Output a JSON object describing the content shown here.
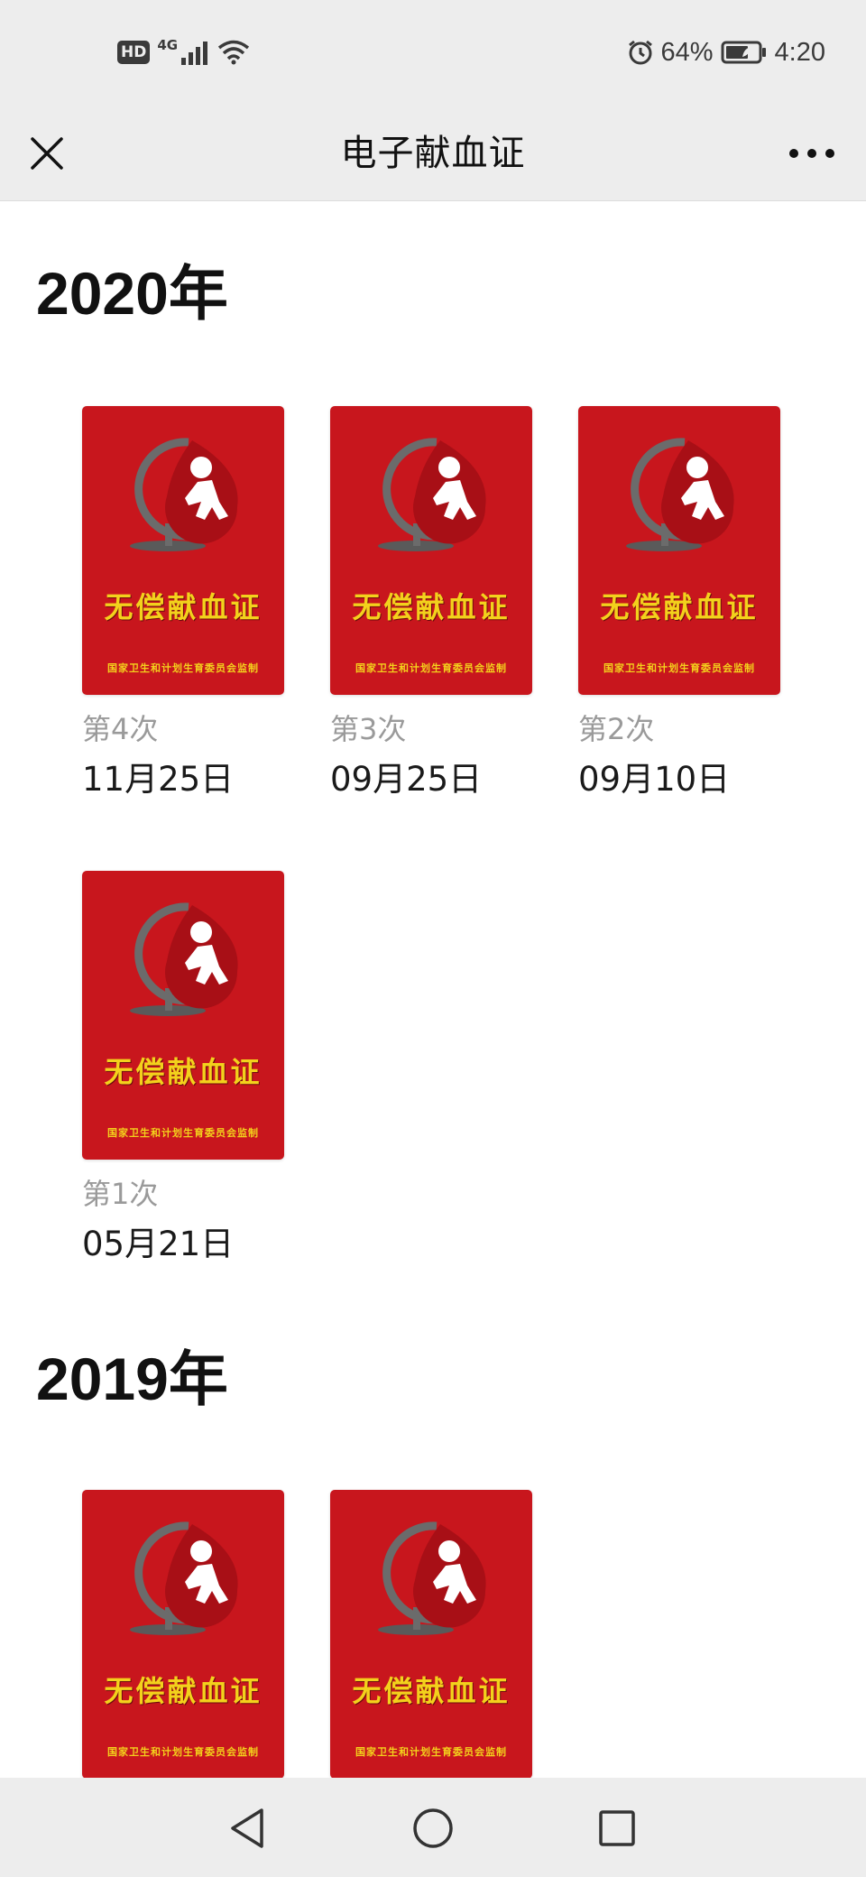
{
  "status_bar": {
    "hd": "HD",
    "network": "4G",
    "battery": "64%",
    "time": "4:20"
  },
  "nav": {
    "title": "电子献血证"
  },
  "card": {
    "title": "无偿献血证",
    "footer": "国家卫生和计划生育委员会监制",
    "colors": {
      "background": "#c8161d",
      "title": "#f3d11c",
      "globe": "#6b6b6b"
    }
  },
  "sections": [
    {
      "year": "2020年",
      "items": [
        {
          "count": "第4次",
          "date": "11月25日"
        },
        {
          "count": "第3次",
          "date": "09月25日"
        },
        {
          "count": "第2次",
          "date": "09月10日"
        },
        {
          "count": "第1次",
          "date": "05月21日"
        }
      ]
    },
    {
      "year": "2019年",
      "items": [
        {
          "count": "",
          "date": ""
        },
        {
          "count": "",
          "date": ""
        }
      ]
    }
  ],
  "icons": {
    "close": "close-icon",
    "more": "more-icon",
    "back": "nav-back-icon",
    "home": "nav-home-icon",
    "recents": "nav-recents-icon"
  }
}
